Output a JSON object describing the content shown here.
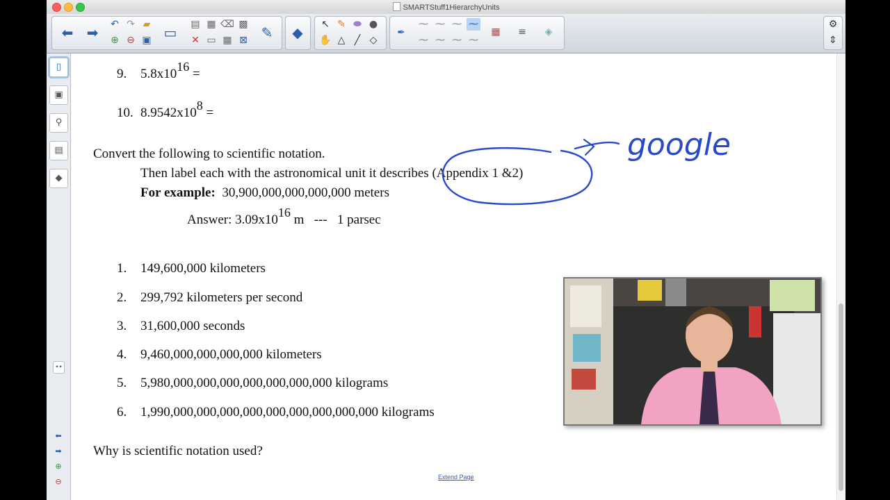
{
  "window": {
    "title": "SMARTStuff1HierarchyUnits"
  },
  "sidebar": {
    "tabs": [
      "page-sorter",
      "gallery",
      "attachments",
      "properties",
      "addons"
    ]
  },
  "content": {
    "items_top": [
      {
        "num": "9.",
        "mantissa": "5.8x10",
        "exp": "16",
        "suffix": " ="
      },
      {
        "num": "10.",
        "mantissa": "8.9542x10",
        "exp": "8",
        "suffix": " ="
      }
    ],
    "instruction": "Convert the following to scientific notation.",
    "instruction2": "Then label each with the astronomical unit it describes (Appendix 1 &2)",
    "example_label": "For example:",
    "example_value": "  30,900,000,000,000,000 meters",
    "answer_prefix": "Answer: 3.09x10",
    "answer_exp": "16",
    "answer_suffix": " m   ---   1 parsec",
    "list": [
      {
        "num": "1.",
        "text": "149,600,000 kilometers"
      },
      {
        "num": "2.",
        "text": "299,792 kilometers per second"
      },
      {
        "num": "3.",
        "text": "31,600,000 seconds"
      },
      {
        "num": "4.",
        "text": "9,460,000,000,000,000 kilometers"
      },
      {
        "num": "5.",
        "text": "5,980,000,000,000,000,000,000,000 kilograms"
      },
      {
        "num": "6.",
        "text": "1,990,000,000,000,000,000,000,000,000,000 kilograms"
      }
    ],
    "question": "Why is scientific notation used?",
    "extend_link": "Extend Page",
    "handwriting": "google"
  },
  "colors": {
    "ink": "#2a49c8",
    "link": "#2a5bd0"
  }
}
